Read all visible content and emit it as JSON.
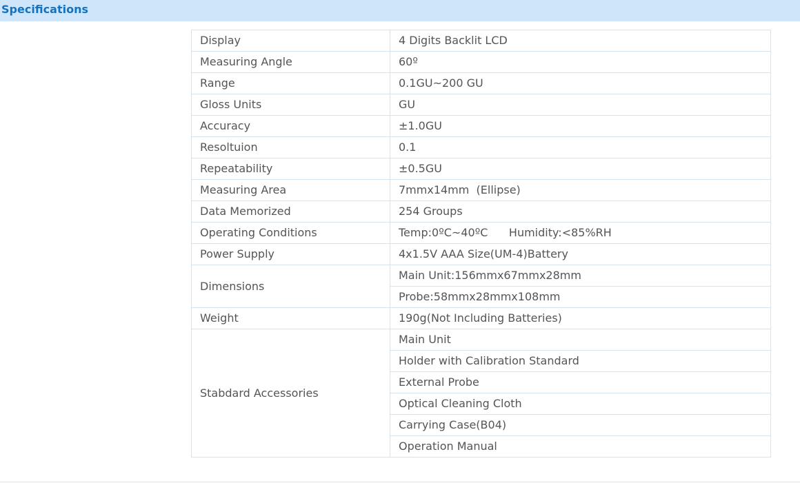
{
  "header": {
    "title": "Specifications"
  },
  "specs": [
    {
      "label": "Display",
      "values": [
        "4 Digits Backlit LCD"
      ]
    },
    {
      "label": "Measuring Angle",
      "values": [
        "60º"
      ]
    },
    {
      "label": "Range",
      "values": [
        "0.1GU~200 GU"
      ]
    },
    {
      "label": "Gloss Units",
      "values": [
        "GU"
      ]
    },
    {
      "label": "Accuracy",
      "values": [
        "±1.0GU"
      ]
    },
    {
      "label": "Resoltuion",
      "values": [
        "0.1"
      ]
    },
    {
      "label": "Repeatability",
      "values": [
        "±0.5GU"
      ]
    },
    {
      "label": "Measuring Area",
      "values": [
        "7mmx14mm  (Ellipse)"
      ]
    },
    {
      "label": "Data Memorized",
      "values": [
        "254 Groups"
      ]
    },
    {
      "label": "Operating Conditions",
      "values": [
        "Temp:0ºC~40ºC      Humidity:<85%RH"
      ]
    },
    {
      "label": "Power Supply",
      "values": [
        "4x1.5V AAA Size(UM-4)Battery"
      ]
    },
    {
      "label": "Dimensions",
      "values": [
        "Main Unit:156mmx67mmx28mm",
        "Probe:58mmx28mmx108mm"
      ]
    },
    {
      "label": "Weight",
      "values": [
        "190g(Not Including Batteries)"
      ]
    },
    {
      "label": "Stabdard Accessories",
      "values": [
        "Main Unit",
        "Holder with Calibration Standard",
        "External Probe",
        "Optical Cleaning Cloth",
        "Carrying Case(B04)",
        "Operation Manual"
      ]
    }
  ]
}
